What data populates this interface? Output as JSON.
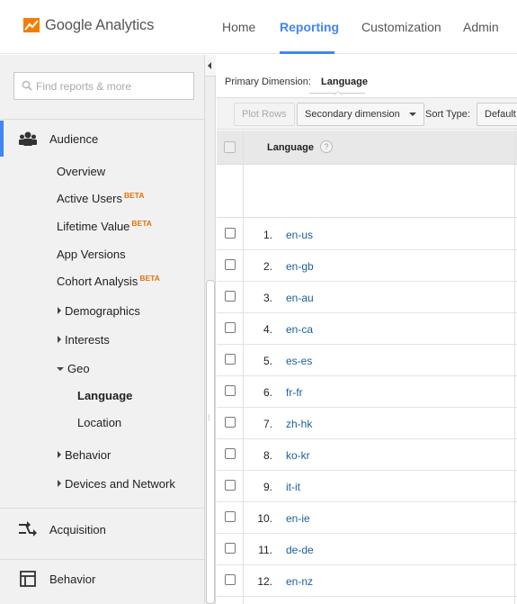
{
  "app": {
    "title": "Google Analytics",
    "logo_icon": "analytics-logo-icon",
    "brand_color": "#f57c00"
  },
  "nav": {
    "items": [
      {
        "label": "Home"
      },
      {
        "label": "Reporting",
        "active": true
      },
      {
        "label": "Customization"
      },
      {
        "label": "Admin"
      }
    ],
    "active_color": "#4285f4"
  },
  "sidebar": {
    "search_placeholder": "Find reports & more",
    "sections": [
      {
        "label": "Audience",
        "icon": "audience-icon"
      },
      {
        "label": "Acquisition",
        "icon": "acquisition-icon"
      },
      {
        "label": "Behavior",
        "icon": "behavior-icon"
      }
    ],
    "audience_items": [
      {
        "label": "Overview"
      },
      {
        "label": "Active Users",
        "badge": "BETA"
      },
      {
        "label": "Lifetime Value",
        "badge": "BETA"
      },
      {
        "label": "App Versions"
      },
      {
        "label": "Cohort Analysis",
        "badge": "BETA"
      },
      {
        "label": "Demographics"
      },
      {
        "label": "Interests"
      },
      {
        "label": "Geo"
      },
      {
        "label": "Language"
      },
      {
        "label": "Location"
      },
      {
        "label": "Behavior"
      },
      {
        "label": "Devices and Network"
      }
    ],
    "badge_color": "#e8710a"
  },
  "report": {
    "primary_dimension_label": "Primary Dimension:",
    "primary_dimension_value": "Language",
    "plot_rows": "Plot Rows",
    "secondary_dimension": "Secondary dimension",
    "sort_type_label": "Sort Type:",
    "sort_type_value": "Default",
    "column_header": "Language",
    "help_glyph": "?",
    "rows": [
      {
        "n": "1.",
        "lang": "en-us"
      },
      {
        "n": "2.",
        "lang": "en-gb"
      },
      {
        "n": "3.",
        "lang": "en-au"
      },
      {
        "n": "4.",
        "lang": "en-ca"
      },
      {
        "n": "5.",
        "lang": "es-es"
      },
      {
        "n": "6.",
        "lang": "fr-fr"
      },
      {
        "n": "7.",
        "lang": "zh-hk"
      },
      {
        "n": "8.",
        "lang": "ko-kr"
      },
      {
        "n": "9.",
        "lang": "it-it"
      },
      {
        "n": "10.",
        "lang": "en-ie"
      },
      {
        "n": "11.",
        "lang": "de-de"
      },
      {
        "n": "12.",
        "lang": "en-nz"
      }
    ],
    "link_color": "#1a5e9e"
  }
}
